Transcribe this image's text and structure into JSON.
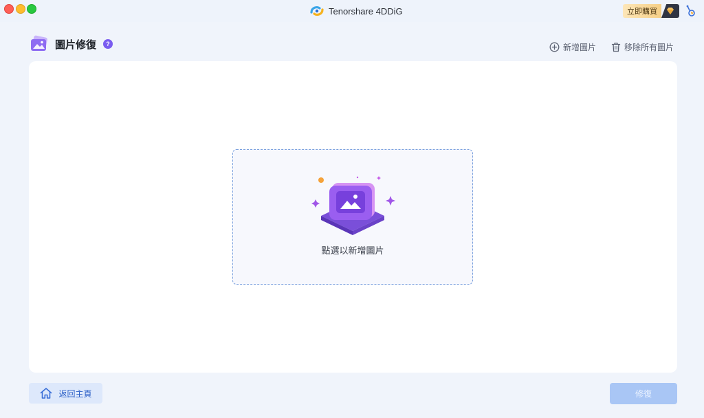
{
  "window": {
    "app_title": "Tenorshare 4DDiG",
    "buy_label": "立即購買"
  },
  "header": {
    "title": "圖片修復",
    "help": "?"
  },
  "actions": {
    "add_label": "新增圖片",
    "remove_all_label": "移除所有圖片"
  },
  "dropzone": {
    "hint": "點選以新增圖片"
  },
  "footer": {
    "home_label": "返回主頁",
    "repair_label": "修復"
  },
  "colors": {
    "accent": "#3a6fd8",
    "purple": "#7a5cf0",
    "repair_disabled": "#a9c6f5"
  },
  "icons": {
    "page": "photo-repair-icon",
    "add": "plus-circle-icon",
    "remove": "trash-icon",
    "home": "home-icon",
    "account": "account-icon",
    "gem": "gem-icon"
  }
}
